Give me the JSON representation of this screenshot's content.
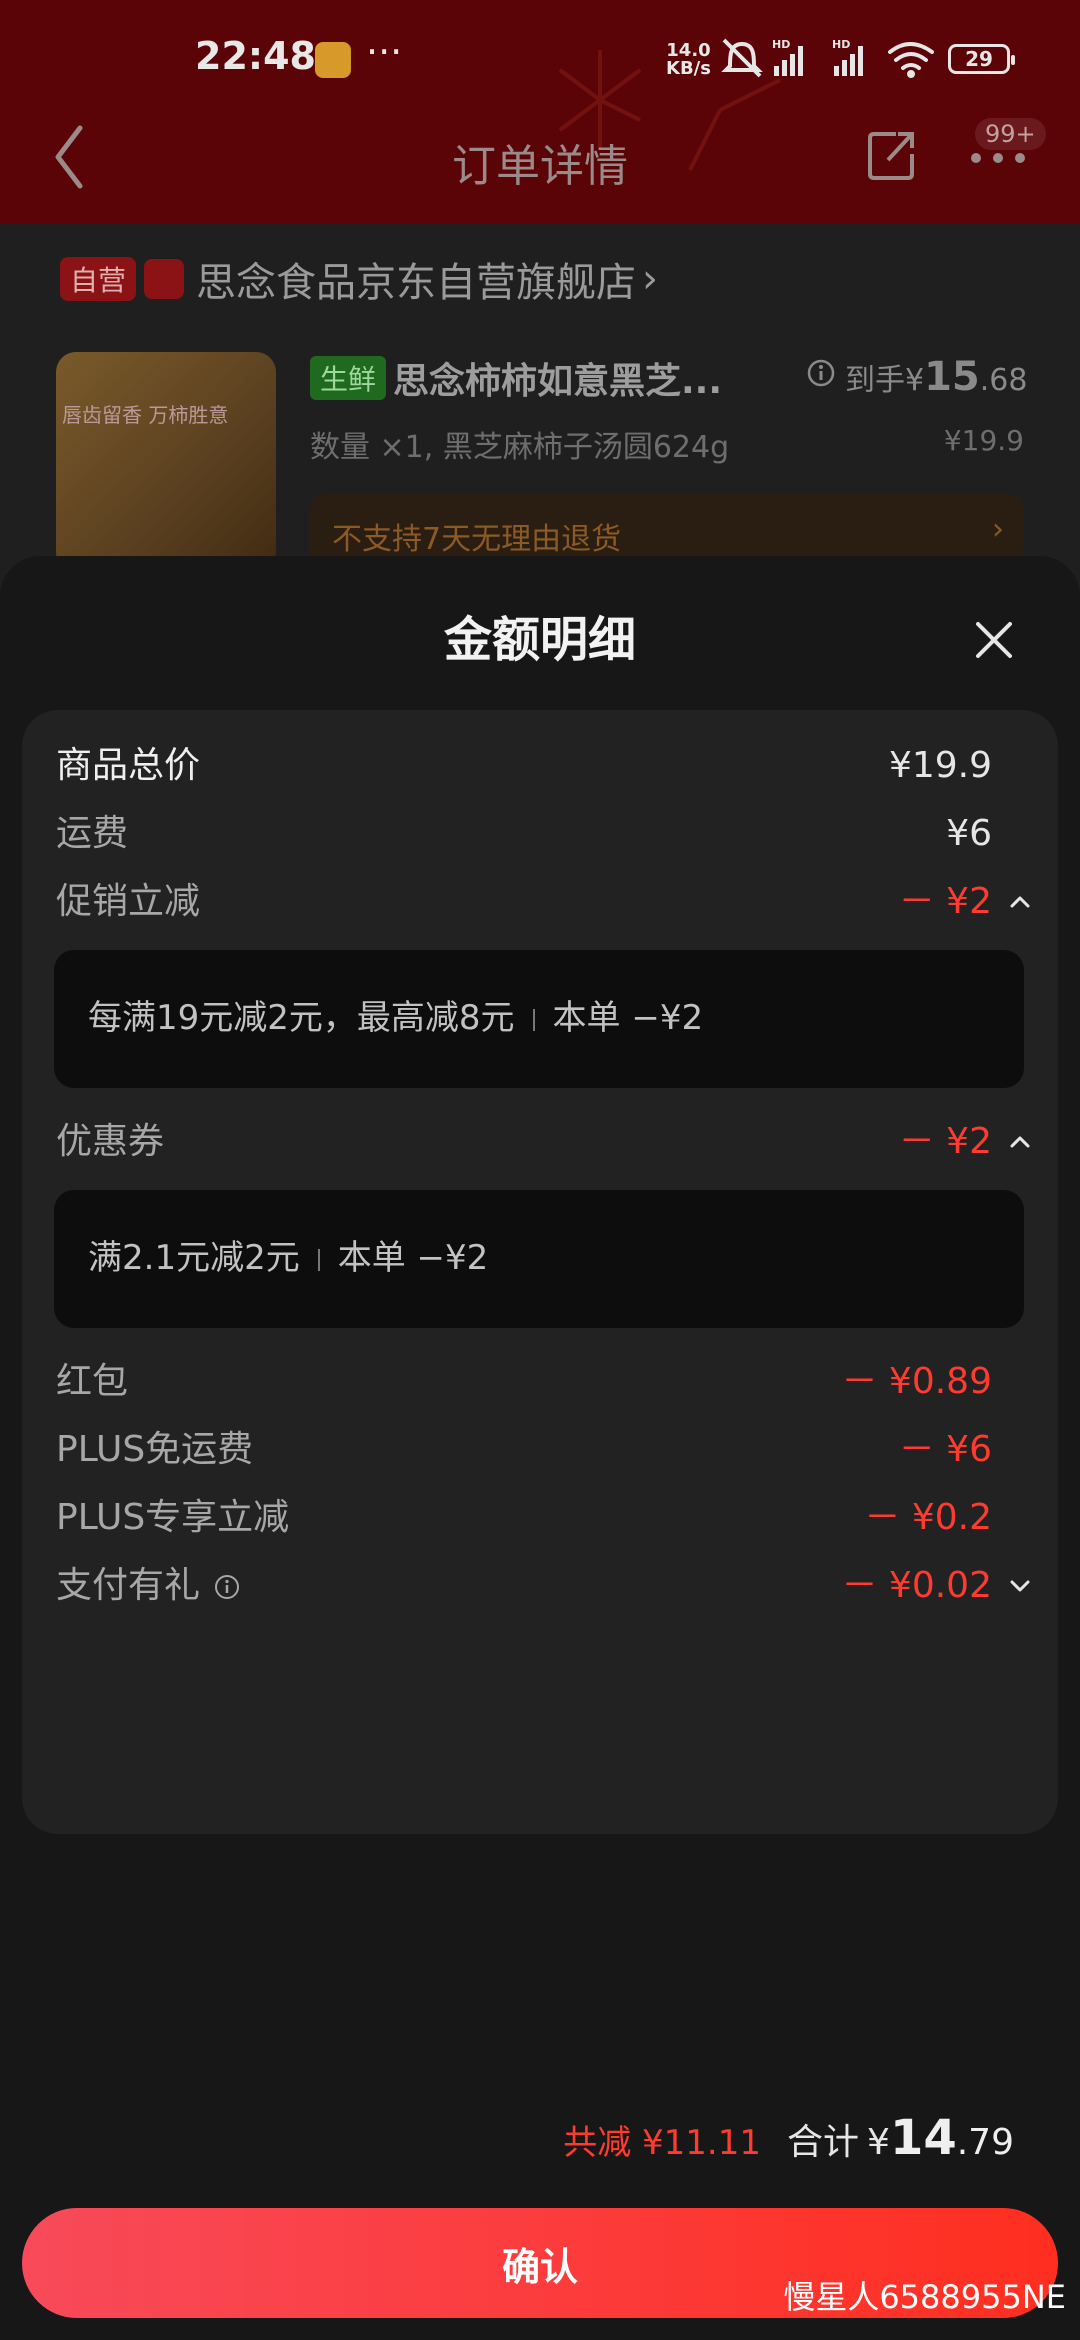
{
  "status": {
    "time": "22:48",
    "dots": "···",
    "speed_value": "14.0",
    "speed_unit": "KB/s",
    "battery": "29"
  },
  "header": {
    "title": "订单详情",
    "badge": "99+"
  },
  "order": {
    "self_tag": "自营",
    "store_name": "思念食品京东自营旗舰店",
    "product_image_text": "唇齿留香 万柿胜意",
    "fresh_tag": "生鲜",
    "product_name": "思念柿柿如意黑芝...",
    "price_prefix": "到手¥",
    "price_int": "15",
    "price_dec": ".68",
    "quantity_spec": "数量 ×1, 黑芝麻柿子汤圆624g",
    "original_price": "¥19.9",
    "return_notice": "不支持7天无理由退货",
    "return_arrow": "›"
  },
  "sheet": {
    "title": "金额明细",
    "rows": {
      "goods_total": {
        "label": "商品总价",
        "value": "¥19.9"
      },
      "shipping": {
        "label": "运费",
        "value": "¥6"
      },
      "promo": {
        "label": "促销立减",
        "value": "－ ¥2"
      },
      "coupon": {
        "label": "优惠券",
        "value": "－ ¥2"
      },
      "red_packet": {
        "label": "红包",
        "value": "－ ¥0.89"
      },
      "plus_shipping": {
        "label": "PLUS免运费",
        "value": "－ ¥6"
      },
      "plus_discount": {
        "label": "PLUS专享立减",
        "value": "－ ¥0.2"
      },
      "pay_gift": {
        "label": "支付有礼",
        "value": "－ ¥0.02"
      }
    },
    "promo_detail": {
      "rule": "每满19元减2元，最高减8元",
      "amount": "本单 −¥2"
    },
    "coupon_detail": {
      "rule": "满2.1元减2元",
      "amount": "本单 −¥2"
    }
  },
  "footer": {
    "total_saved": "共减 ¥11.11",
    "total_label": "合计",
    "total_yen": "¥",
    "total_int": "14",
    "total_dec": ".79",
    "confirm_label": "确认"
  },
  "watermark": "慢星人6588955NE"
}
